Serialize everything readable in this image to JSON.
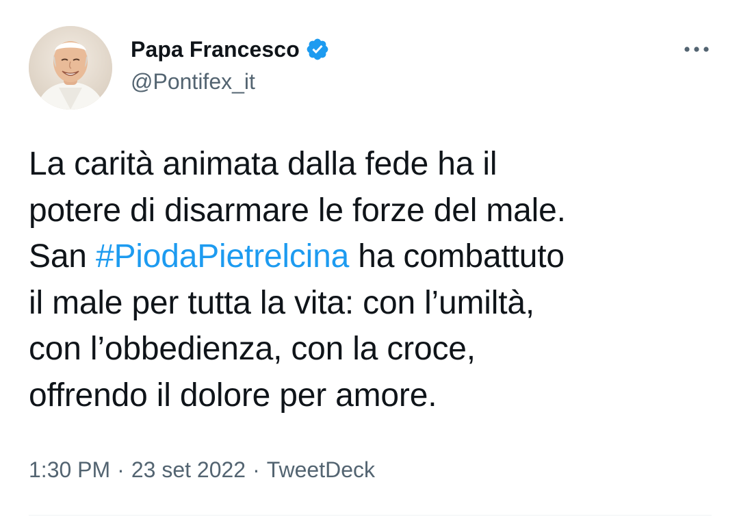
{
  "author": {
    "display_name": "Papa Francesco",
    "handle": "@Pontifex_it",
    "verified": true
  },
  "tweet": {
    "lines": [
      {
        "before": "La carità animata dalla fede ha il",
        "hashtag": "",
        "after": ""
      },
      {
        "before": "potere di disarmare le forze del male.",
        "hashtag": "",
        "after": ""
      },
      {
        "before": "San ",
        "hashtag": "#PiodaPietrelcina",
        "after": " ha combattuto"
      },
      {
        "before": "il male per tutta la vita: con l’umiltà,",
        "hashtag": "",
        "after": ""
      },
      {
        "before": "con l’obbedienza, con la croce,",
        "hashtag": "",
        "after": ""
      },
      {
        "before": "offrendo il dolore per amore.",
        "hashtag": "",
        "after": ""
      }
    ]
  },
  "meta": {
    "time": "1:30 PM",
    "separator": "·",
    "date": "23 set 2022",
    "source": "TweetDeck"
  },
  "colors": {
    "text": "#0f1419",
    "secondary": "#536471",
    "link": "#1d9bf0",
    "verified": "#1d9bf0",
    "divider": "#eff3f4"
  },
  "icons": {
    "verified": "verified-badge-icon",
    "more": "more-options-icon",
    "avatar": "profile-photo"
  }
}
